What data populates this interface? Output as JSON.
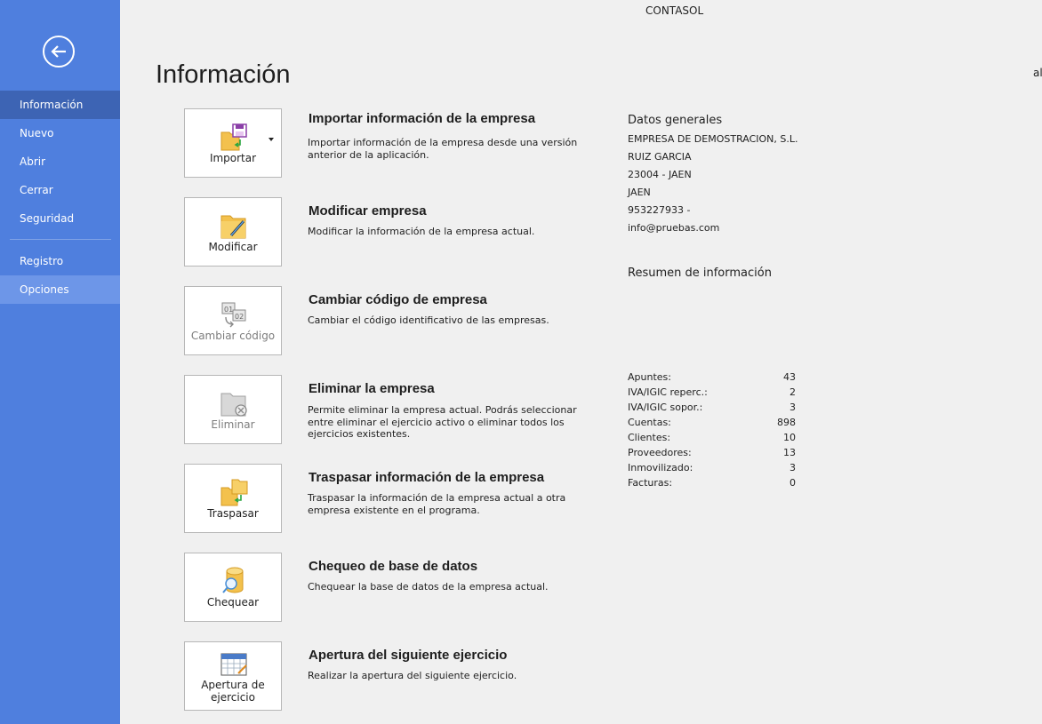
{
  "app_title": "CONTASOL",
  "page_title": "Información",
  "edge_text": "al",
  "sidebar": {
    "back_icon": "arrow-left-circle-icon",
    "items": [
      {
        "label": "Información"
      },
      {
        "label": "Nuevo"
      },
      {
        "label": "Abrir"
      },
      {
        "label": "Cerrar"
      },
      {
        "label": "Seguridad"
      },
      {
        "label": "Registro"
      },
      {
        "label": "Opciones"
      }
    ]
  },
  "actions": [
    {
      "button": "Importar",
      "icon": "import-icon",
      "title": "Importar información de la empresa",
      "desc": "Importar información de la empresa desde una versión anterior de la aplicación."
    },
    {
      "button": "Modificar",
      "icon": "folder-edit-icon",
      "title": "Modificar empresa",
      "desc": "Modificar la información de la empresa actual."
    },
    {
      "button": "Cambiar código",
      "icon": "change-code-icon",
      "title": "Cambiar código de empresa",
      "desc": "Cambiar el código identificativo de las empresas."
    },
    {
      "button": "Eliminar",
      "icon": "folder-delete-icon",
      "title": "Eliminar la empresa",
      "desc": "Permite eliminar la empresa actual. Podrás seleccionar entre eliminar el ejercicio activo o eliminar todos los ejercicios existentes."
    },
    {
      "button": "Traspasar",
      "icon": "transfer-icon",
      "title": "Traspasar información de la empresa",
      "desc": "Traspasar la información de la empresa actual a otra empresa existente en el programa."
    },
    {
      "button": "Chequear",
      "icon": "database-check-icon",
      "title": "Chequeo de base de datos",
      "desc": "Chequear la base de datos de la empresa actual."
    },
    {
      "button_line1": "Apertura de",
      "button_line2": "ejercicio",
      "icon": "calendar-icon",
      "title": "Apertura del siguiente ejercicio",
      "desc": "Realizar la apertura del siguiente ejercicio."
    }
  ],
  "general": {
    "heading": "Datos generales",
    "lines": [
      "EMPRESA DE DEMOSTRACION, S.L.",
      "RUIZ GARCIA",
      "23004 - JAEN",
      "JAEN",
      "953227933 -",
      "info@pruebas.com"
    ]
  },
  "summary": {
    "heading": "Resumen de información",
    "stats": [
      {
        "label": "Apuntes:",
        "value": "43"
      },
      {
        "label": "IVA/IGIC reperc.:",
        "value": "2"
      },
      {
        "label": "IVA/IGIC sopor.:",
        "value": "3"
      },
      {
        "label": "Cuentas:",
        "value": "898"
      },
      {
        "label": "Clientes:",
        "value": "10"
      },
      {
        "label": "Proveedores:",
        "value": "13"
      },
      {
        "label": "Inmovilizado:",
        "value": "3"
      },
      {
        "label": "Facturas:",
        "value": "0"
      }
    ]
  }
}
